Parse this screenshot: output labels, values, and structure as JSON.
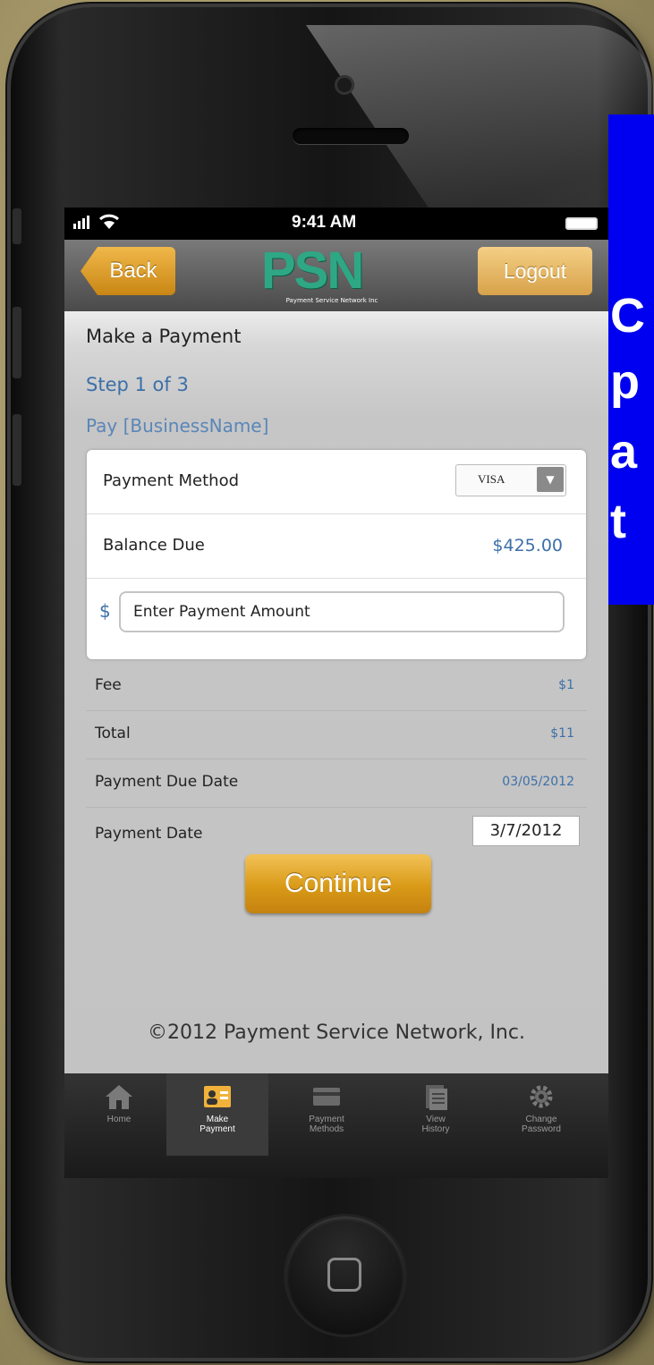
{
  "statusbar": {
    "signal": "▐▐▐ ◌",
    "time": "9:41 AM"
  },
  "navbar": {
    "back_label": "Back",
    "logout_label": "Logout",
    "logo_text": "PSN",
    "logo_tagline": "Payment Service Network Inc"
  },
  "page": {
    "title": "Make a Payment",
    "step": "Step 1 of 3",
    "pay_to": "Pay [BusinessName]"
  },
  "form": {
    "payment_method_label": "Payment Method",
    "payment_method_value": "VISA",
    "balance_label": "Balance Due",
    "balance_value": "$425.00",
    "currency_symbol": "$",
    "amount_placeholder": "Enter Payment Amount",
    "fee_label": "Fee",
    "fee_value": "$1",
    "total_label": "Total",
    "total_value": "$11",
    "due_date_label": "Payment Due Date",
    "due_date_value": "03/05/2012",
    "payment_date_label": "Payment Date",
    "payment_date_value": "3/7/2012",
    "continue_label": "Continue"
  },
  "footer": {
    "copyright": "©2012 Payment Service Network, Inc."
  },
  "tabbar": {
    "items": [
      {
        "label": "Home",
        "icon": "home-icon",
        "active": false
      },
      {
        "label": "Make\nPayment",
        "icon": "payment-icon",
        "active": true
      },
      {
        "label": "Payment\nMethods",
        "icon": "card-icon",
        "active": false
      },
      {
        "label": "View\nHistory",
        "icon": "history-icon",
        "active": false
      },
      {
        "label": "Change\nPassword",
        "icon": "gear-icon",
        "active": false
      }
    ]
  },
  "overlay": {
    "letters": [
      "C",
      "p",
      "a",
      "t"
    ]
  },
  "colors": {
    "accent": "#d99a17",
    "link": "#3d6fa8",
    "overlay": "#0000f0"
  }
}
